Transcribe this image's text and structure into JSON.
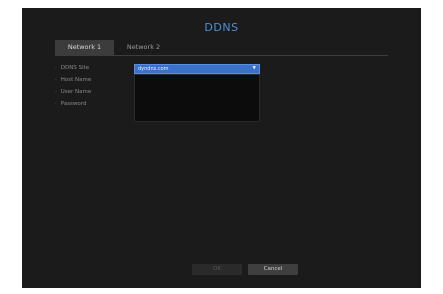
{
  "dialog": {
    "title": "DDNS"
  },
  "tabs": [
    {
      "label": "Network 1",
      "active": true
    },
    {
      "label": "Network 2",
      "active": false
    }
  ],
  "fields": {
    "ddns_site_label": "DDNS Site",
    "host_name_label": "Host Name",
    "user_name_label": "User Name",
    "password_label": "Password",
    "ddns_site_value": "dyndns.com"
  },
  "buttons": {
    "ok_label": "OK",
    "cancel_label": "Cancel"
  },
  "colors": {
    "accent": "#4a90d9",
    "selected": "#3a72c9",
    "panel": "#1b1b1b"
  },
  "icons": {
    "dropdown": "chevron-down-icon"
  }
}
